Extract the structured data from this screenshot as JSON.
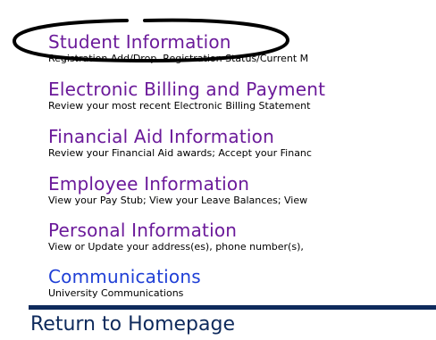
{
  "menu": {
    "items": [
      {
        "title": "Student Information",
        "description": "Registration Add/Drop, Registration Status/Current M"
      },
      {
        "title": "Electronic Billing and Payment",
        "description": "Review your most recent Electronic Billing Statement"
      },
      {
        "title": "Financial Aid Information",
        "description": "Review your Financial Aid awards; Accept your Financ"
      },
      {
        "title": "Employee Information",
        "description": "View your Pay Stub; View your Leave Balances; View"
      },
      {
        "title": "Personal Information",
        "description": "View or Update your address(es), phone number(s),"
      },
      {
        "title": "Communications",
        "description": "University Communications"
      }
    ]
  },
  "footer": {
    "return_label": "Return to Homepage"
  },
  "colors": {
    "visited_link": "#6b1a9a",
    "link": "#1f3fd6",
    "divider": "#0e2a5c",
    "annotation": "#000000"
  }
}
